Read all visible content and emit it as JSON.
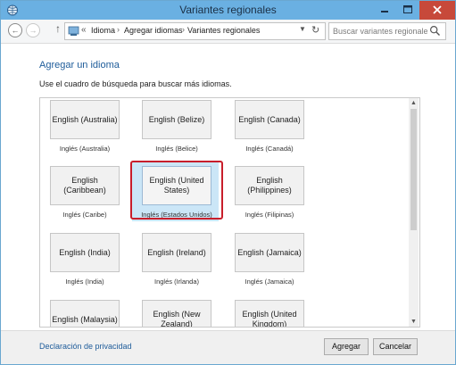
{
  "window": {
    "title": "Variantes regionales"
  },
  "nav": {
    "breadcrumb_prefix": "«",
    "breadcrumbs": [
      "Idioma",
      "Agregar idiomas",
      "Variantes regionales"
    ],
    "search_placeholder": "Buscar variantes regionales"
  },
  "main": {
    "heading": "Agregar un idioma",
    "instructions": "Use el cuadro de búsqueda para buscar más idiomas."
  },
  "tiles": [
    {
      "label": "English (Australia)",
      "sublabel": "Inglés (Australia)"
    },
    {
      "label": "English (Belize)",
      "sublabel": "Inglés (Belice)"
    },
    {
      "label": "English (Canada)",
      "sublabel": "Inglés (Canadá)"
    },
    {
      "label": "English (Caribbean)",
      "sublabel": "Inglés (Caribe)"
    },
    {
      "label": "English (United States)",
      "sublabel": "Inglés (Estados Unidos)",
      "selected": true
    },
    {
      "label": "English (Philippines)",
      "sublabel": "Inglés (Filipinas)"
    },
    {
      "label": "English (India)",
      "sublabel": "Inglés (India)"
    },
    {
      "label": "English (Ireland)",
      "sublabel": "Inglés (Irlanda)"
    },
    {
      "label": "English (Jamaica)",
      "sublabel": "Inglés (Jamaica)"
    },
    {
      "label": "English (Malaysia)",
      "sublabel": ""
    },
    {
      "label": "English (New Zealand)",
      "sublabel": ""
    },
    {
      "label": "English (United Kingdom)",
      "sublabel": ""
    }
  ],
  "footer": {
    "privacy_link": "Declaración de privacidad",
    "add_button": "Agregar",
    "cancel_button": "Cancelar"
  },
  "colors": {
    "titlebar": "#6ab0e2",
    "close_button": "#c7493a",
    "accent_text": "#1e5c9a",
    "selection_fill": "#cbe6f7",
    "highlight_outline": "#c81e2b"
  },
  "icons": {
    "app": "globe-clock-icon",
    "back": "back-arrow-icon",
    "forward": "forward-arrow-icon",
    "up": "up-arrow-icon",
    "location": "control-panel-icon",
    "refresh": "refresh-icon",
    "search": "search-icon",
    "scroll_up": "scroll-up-arrow-icon",
    "scroll_down": "scroll-down-arrow-icon"
  }
}
